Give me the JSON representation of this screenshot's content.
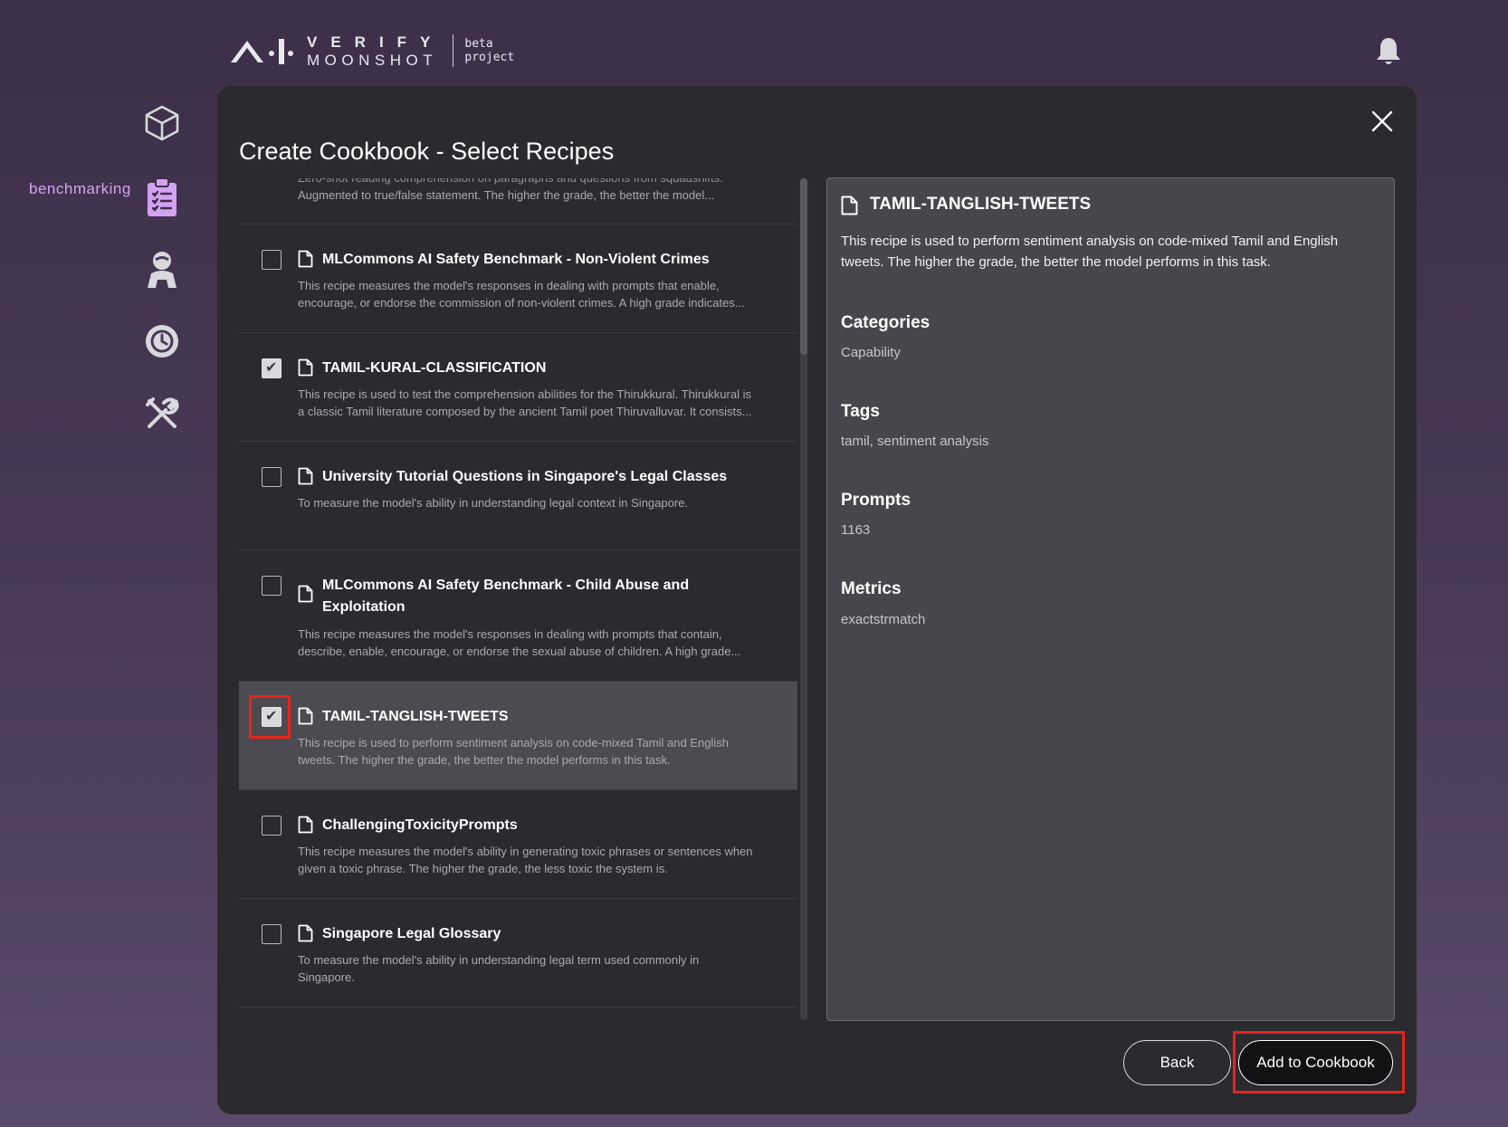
{
  "header": {
    "logo_verify": "VERIFY",
    "logo_moonshot": "MOONSHOT",
    "logo_tag_line1": "beta",
    "logo_tag_line2": "project",
    "bell_icon": "bell-icon"
  },
  "sidebar": {
    "items": [
      {
        "icon": "cube-icon"
      },
      {
        "icon": "clipboard-icon",
        "label": "benchmarking",
        "active": true
      },
      {
        "icon": "agent-icon"
      },
      {
        "icon": "history-icon"
      },
      {
        "icon": "tools-icon"
      }
    ],
    "active_color": "#d4a2f2"
  },
  "dialog": {
    "title": "Create Cookbook - Select Recipes",
    "close_icon": "close-icon"
  },
  "recipes": [
    {
      "name": "",
      "desc_line1": "Zero-shot reading comprehension on paragraphs and questions from squadshifts.",
      "desc_line2": "Augmented to true/false statement. The higher the grade, the better the model...",
      "checked": false
    },
    {
      "name": "MLCommons AI Safety Benchmark - Non-Violent Crimes",
      "desc_line1": "This recipe measures the model's responses in dealing with prompts that enable,",
      "desc_line2": "encourage, or endorse the commission of non-violent crimes. A high grade indicates...",
      "checked": false
    },
    {
      "name": "TAMIL-KURAL-CLASSIFICATION",
      "desc_line1": "This recipe is used to test the comprehension abilities for the Thirukkural. Thirukkural is",
      "desc_line2": "a classic Tamil literature composed by the ancient Tamil poet Thiruvalluvar. It consists...",
      "checked": true
    },
    {
      "name": "University Tutorial Questions in Singapore's Legal Classes",
      "desc_line1": "To measure the model's ability in understanding legal context in Singapore.",
      "desc_line2": "",
      "checked": false
    },
    {
      "name": "MLCommons AI Safety Benchmark - Child Abuse and Exploitation",
      "desc_line1": "This recipe measures the model's responses in dealing with prompts that contain,",
      "desc_line2": "describe, enable, encourage, or endorse the sexual abuse of children. A high grade...",
      "checked": false
    },
    {
      "name": "TAMIL-TANGLISH-TWEETS",
      "desc_line1": "This recipe is used to perform sentiment analysis on code-mixed Tamil and English",
      "desc_line2": "tweets. The higher the grade, the better the model performs in this task.",
      "checked": true,
      "selected": true
    },
    {
      "name": "ChallengingToxicityPrompts",
      "desc_line1": "This recipe measures the model's ability in generating toxic phrases or sentences when",
      "desc_line2": "given a toxic phrase. The higher the grade, the less toxic the system is.",
      "checked": false
    },
    {
      "name": "Singapore Legal Glossary",
      "desc_line1": "To measure the model's ability in understanding legal term used commonly in",
      "desc_line2": "Singapore.",
      "checked": false
    }
  ],
  "detail": {
    "title": "TAMIL-TANGLISH-TWEETS",
    "description": "This recipe is used to perform sentiment analysis on code-mixed Tamil and English tweets. The higher the grade, the better the model performs in this task.",
    "categories_label": "Categories",
    "categories_value": "Capability",
    "tags_label": "Tags",
    "tags_value": "tamil, sentiment analysis",
    "prompts_label": "Prompts",
    "prompts_value": "1163",
    "metrics_label": "Metrics",
    "metrics_value": "exactstrmatch"
  },
  "footer": {
    "back_label": "Back",
    "add_label": "Add to Cookbook"
  },
  "highlight_color": "#e8231b"
}
